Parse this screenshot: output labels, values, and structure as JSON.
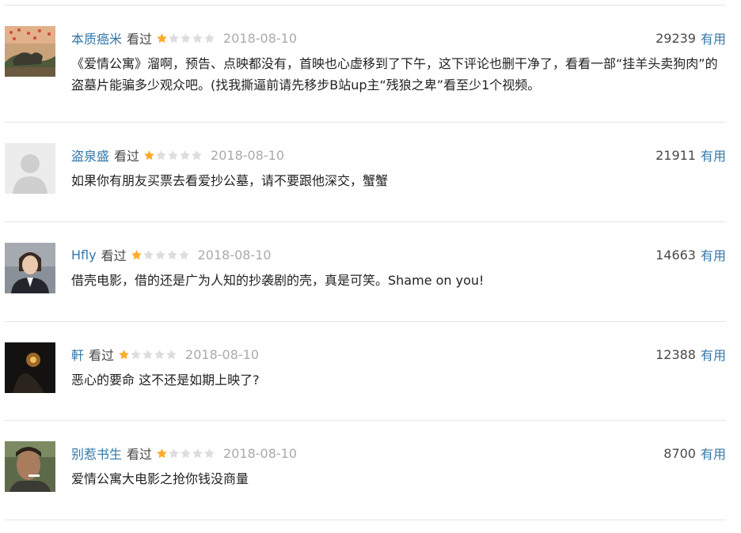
{
  "comments": [
    {
      "author": "本质癌米",
      "status": "看过",
      "rating": 1,
      "date": "2018-08-10",
      "votes": "29239",
      "useful_label": "有用",
      "text": "《爱情公寓》溜啊，预告、点映都没有，首映也心虚移到了下午，这下评论也删干净了，看看一部“挂羊头卖狗肉”的盗墓片能骗多少观众吧。(找我撕逼前请先移步B站up主“残狼之卑”看至少1个视频。"
    },
    {
      "author": "盗泉盛",
      "status": "看过",
      "rating": 1,
      "date": "2018-08-10",
      "votes": "21911",
      "useful_label": "有用",
      "text": "如果你有朋友买票去看爱抄公墓，请不要跟他深交，蟹蟹"
    },
    {
      "author": "Hfly",
      "status": "看过",
      "rating": 1,
      "date": "2018-08-10",
      "votes": "14663",
      "useful_label": "有用",
      "text": "借壳电影，借的还是广为人知的抄袭剧的壳，真是可笑。Shame on you!"
    },
    {
      "author": "軒",
      "status": "看过",
      "rating": 1,
      "date": "2018-08-10",
      "votes": "12388",
      "useful_label": "有用",
      "text": "恶心的要命 这不还是如期上映了?"
    },
    {
      "author": "别惹书生",
      "status": "看过",
      "rating": 1,
      "date": "2018-08-10",
      "votes": "8700",
      "useful_label": "有用",
      "text": "爱情公寓大电影之抢你钱没商量"
    }
  ],
  "colors": {
    "link": "#3377aa",
    "star_on": "#ffac2d",
    "star_off": "#dddddd"
  }
}
